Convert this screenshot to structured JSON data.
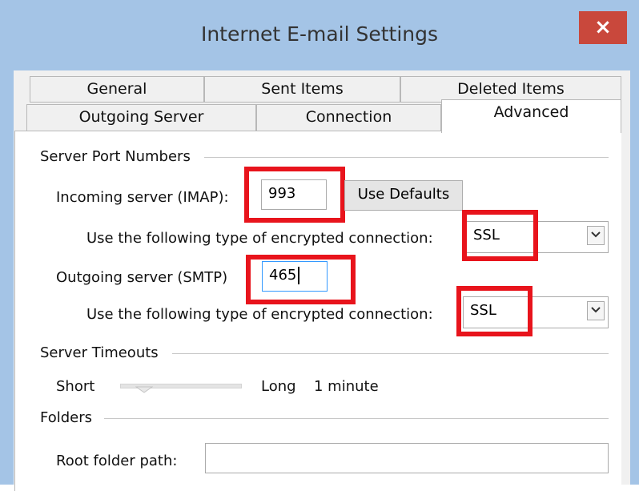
{
  "window": {
    "title": "Internet E-mail Settings",
    "close_glyph": "×"
  },
  "tabs": {
    "row1": [
      "General",
      "Sent Items",
      "Deleted Items"
    ],
    "row2": [
      "Outgoing Server",
      "Connection",
      "Advanced"
    ],
    "active": "Advanced"
  },
  "server_ports": {
    "group_label": "Server Port Numbers",
    "incoming_label": "Incoming server (IMAP):",
    "incoming_value": "993",
    "use_defaults_label": "Use Defaults",
    "encryption_label_1": "Use the following type of encrypted connection:",
    "encryption_value_1": "SSL",
    "outgoing_label": "Outgoing server (SMTP)",
    "outgoing_value": "465",
    "encryption_label_2": "Use the following type of encrypted connection:",
    "encryption_value_2": "SSL"
  },
  "timeouts": {
    "group_label": "Server Timeouts",
    "short_label": "Short",
    "long_label": "Long",
    "value_text": "1 minute",
    "slider_level": 0.15
  },
  "folders": {
    "group_label": "Folders",
    "root_label": "Root folder path:",
    "root_value": ""
  },
  "colors": {
    "highlight": "#e8141c",
    "close_button": "#c9483c",
    "frame": "#a4c4e6"
  }
}
